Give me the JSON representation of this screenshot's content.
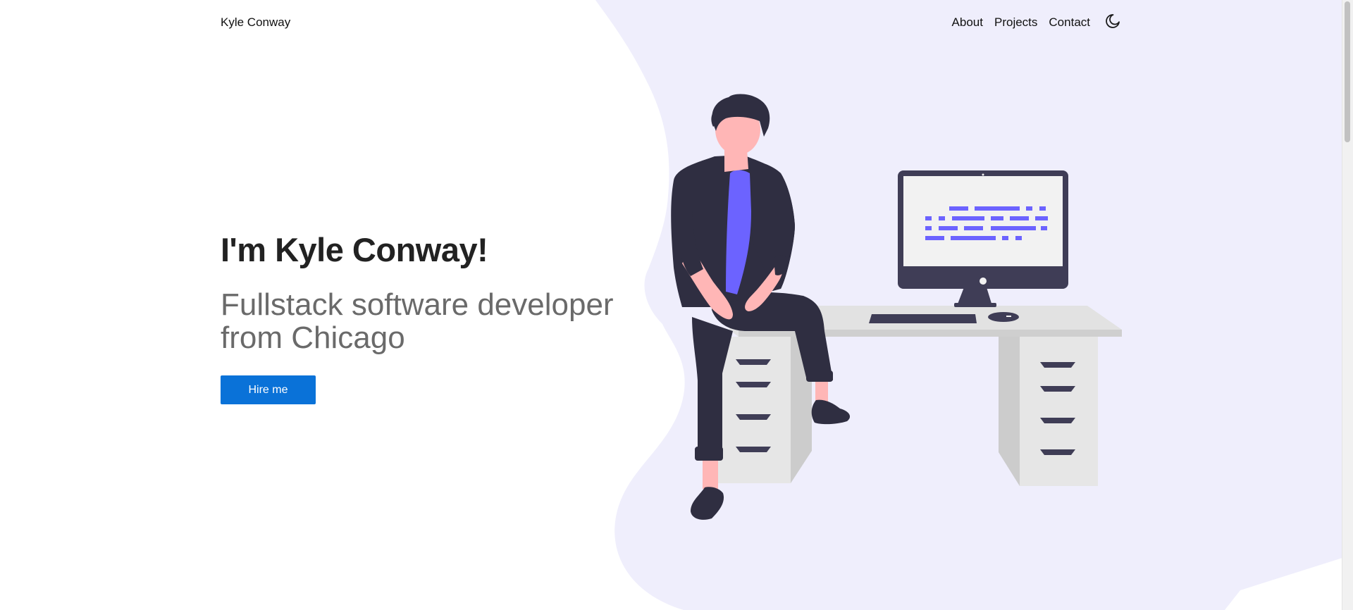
{
  "nav": {
    "brand": "Kyle Conway",
    "links": [
      "About",
      "Projects",
      "Contact"
    ],
    "theme_icon": "moon-icon"
  },
  "hero": {
    "title": "I'm Kyle Conway!",
    "subtitle": "Fullstack software developer from Chicago",
    "cta_label": "Hire me"
  },
  "illustration": {
    "name": "developer-at-desk-illustration"
  },
  "colors": {
    "accent": "#0a72d8",
    "blob": "#efeefc",
    "figure_dark": "#2f2e41",
    "shirt": "#6c63ff",
    "skin": "#ffb6b6",
    "desk": "#e6e6e6",
    "desk_shadow": "#d0d0d0",
    "screen": "#f2f2f2",
    "monitor": "#3f3d56"
  }
}
